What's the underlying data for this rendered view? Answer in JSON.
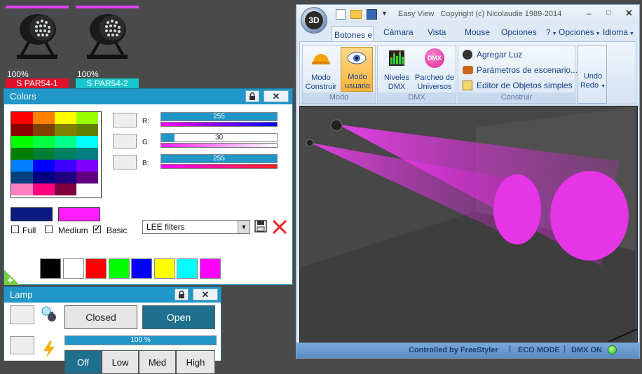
{
  "fixtures": [
    {
      "percent": "100%",
      "name": "S PAR54-1",
      "label_color": "#e0102a"
    },
    {
      "percent": "100%",
      "name": "S PAR54-2",
      "label_color": "#18c6cc"
    }
  ],
  "colors_panel": {
    "title": "Colors",
    "sliders": [
      {
        "label": "R:",
        "value": "255",
        "fill": 1.0
      },
      {
        "label": "G:",
        "value": "30",
        "fill": 0.1176
      },
      {
        "label": "B:",
        "value": "255",
        "fill": 1.0
      }
    ],
    "checkboxes": [
      {
        "label": "Full",
        "checked": false
      },
      {
        "label": "Medium",
        "checked": false
      },
      {
        "label": "Basic",
        "checked": true
      }
    ],
    "filter_select": "LEE filters",
    "selected_primary": "#0b1b80",
    "selected_secondary": "#ff1eff",
    "palette": [
      [
        "#ff0000",
        "#ff8000",
        "#ffff00",
        "#99ff00"
      ],
      [
        "#8b0000",
        "#804000",
        "#808000",
        "#608000"
      ],
      [
        "#00ff00",
        "#00ff40",
        "#00ff88",
        "#00ffff"
      ],
      [
        "#008000",
        "#008030",
        "#008060",
        "#008080"
      ],
      [
        "#0080ff",
        "#0000ff",
        "#4000ff",
        "#8000ff"
      ],
      [
        "#004080",
        "#000080",
        "#200080",
        "#600080"
      ],
      [
        "#ff80c0",
        "#ff0080",
        "#800040",
        "#ffffff"
      ]
    ],
    "quick_colors": [
      "#000000",
      "#ffffff",
      "#ff0000",
      "#00ff00",
      "#0000ff",
      "#ffff00",
      "#00ffff",
      "#ff00ff"
    ]
  },
  "lamp_panel": {
    "title": "Lamp",
    "closed_label": "Closed",
    "open_label": "Open",
    "dimmer_value": "100 %",
    "dimmer_fill": 1.0,
    "bottom_buttons": [
      "Off",
      "Low",
      "Med",
      "High"
    ]
  },
  "easyview": {
    "title": "Easy View   Copyright (c) Nicolaudie 1989-2014",
    "logo": "3D",
    "tabs": [
      "Botones es",
      "Cámara",
      "Vista",
      "Mouse",
      "Opciones d"
    ],
    "right_menus": [
      "?",
      "Opciones",
      "Idioma"
    ],
    "groups": [
      {
        "label": "Modo",
        "buttons": [
          {
            "line1": "Modo",
            "line2": "Construir"
          },
          {
            "line1": "Modo",
            "line2": "usuario"
          }
        ]
      },
      {
        "label": "DMX",
        "buttons": [
          {
            "line1": "Niveles",
            "line2": "DMX"
          },
          {
            "line1": "Parcheo de",
            "line2": "Universos"
          }
        ]
      },
      {
        "label": "Construir",
        "items": [
          "Agregar Luz",
          "Parámetros de escenario...",
          "Editor de Objetos simples"
        ]
      }
    ],
    "undo": {
      "line1": "Undo",
      "line2": "Redo"
    },
    "status": [
      "Controlled by FreeStyler",
      "ECO MODE",
      "DMX ON"
    ],
    "dmx_badge": "DMX"
  }
}
